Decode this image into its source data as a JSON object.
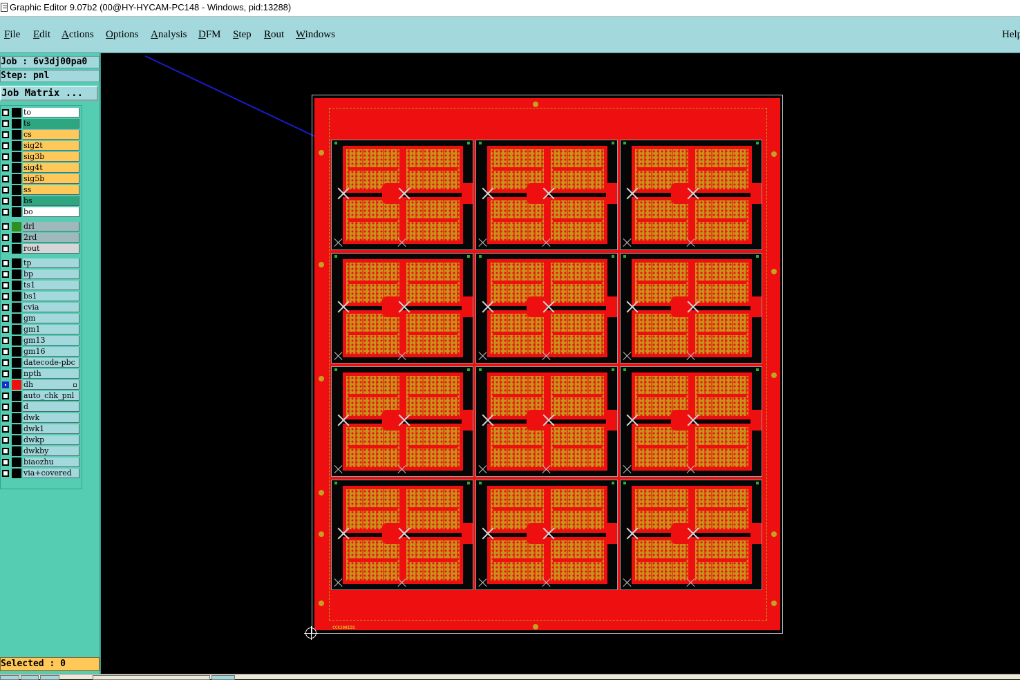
{
  "window": {
    "title": "Graphic Editor 9.07b2 (00@HY-HYCAM-PC148 - Windows, pid:13288)"
  },
  "menu": {
    "items": [
      "File",
      "Edit",
      "Actions",
      "Options",
      "Analysis",
      "DFM",
      "Step",
      "Rout",
      "Windows"
    ],
    "help": "Help"
  },
  "job": {
    "job_label": "Job : 6v3dj00pa0",
    "step_label": "Step: pnl",
    "matrix_button": "Job Matrix ..."
  },
  "layers": [
    {
      "name": "to",
      "type": "board",
      "color": "#000000",
      "checked": false
    },
    {
      "name": "ts",
      "type": "board",
      "color": "#000000",
      "checked": false
    },
    {
      "name": "cs",
      "type": "board",
      "color": "#000000",
      "checked": false
    },
    {
      "name": "sig2t",
      "type": "board",
      "color": "#000000",
      "checked": false
    },
    {
      "name": "sig3b",
      "type": "board",
      "color": "#000000",
      "checked": false
    },
    {
      "name": "sig4t",
      "type": "board",
      "color": "#000000",
      "checked": false
    },
    {
      "name": "sig5b",
      "type": "board",
      "color": "#000000",
      "checked": false
    },
    {
      "name": "ss",
      "type": "board",
      "color": "#000000",
      "checked": false
    },
    {
      "name": "bs",
      "type": "board",
      "color": "#000000",
      "checked": false
    },
    {
      "name": "bo",
      "type": "board",
      "color": "#000000",
      "checked": false
    },
    {
      "name": "drl",
      "type": "drill",
      "color": "#2f8e1f",
      "checked": false
    },
    {
      "name": "2rd",
      "type": "drill",
      "color": "#000000",
      "checked": false
    },
    {
      "name": "rout",
      "type": "rout",
      "color": "#000000",
      "checked": false
    },
    {
      "name": "tp",
      "type": "misc",
      "color": "#000000",
      "checked": false
    },
    {
      "name": "bp",
      "type": "misc",
      "color": "#000000",
      "checked": false
    },
    {
      "name": "ts1",
      "type": "misc",
      "color": "#000000",
      "checked": false
    },
    {
      "name": "bs1",
      "type": "misc",
      "color": "#000000",
      "checked": false
    },
    {
      "name": "cvia",
      "type": "misc",
      "color": "#000000",
      "checked": false
    },
    {
      "name": "gm",
      "type": "misc",
      "color": "#000000",
      "checked": false
    },
    {
      "name": "gm1",
      "type": "misc",
      "color": "#000000",
      "checked": false
    },
    {
      "name": "gm13",
      "type": "misc",
      "color": "#000000",
      "checked": false
    },
    {
      "name": "gm16",
      "type": "misc",
      "color": "#000000",
      "checked": false
    },
    {
      "name": "datecode-pbc",
      "type": "misc",
      "color": "#000000",
      "checked": false
    },
    {
      "name": "npth",
      "type": "misc",
      "color": "#000000",
      "checked": false
    },
    {
      "name": "dh",
      "type": "misc",
      "color": "#ee1010",
      "checked": true
    },
    {
      "name": "auto_chk_pnl",
      "type": "misc",
      "color": "#000000",
      "checked": false
    },
    {
      "name": "d",
      "type": "misc",
      "color": "#000000",
      "checked": false
    },
    {
      "name": "dwk",
      "type": "misc",
      "color": "#000000",
      "checked": false
    },
    {
      "name": "dwk1",
      "type": "misc",
      "color": "#000000",
      "checked": false
    },
    {
      "name": "dwkp",
      "type": "misc",
      "color": "#000000",
      "checked": false
    },
    {
      "name": "dwkby",
      "type": "misc",
      "color": "#000000",
      "checked": false
    },
    {
      "name": "biaozhu",
      "type": "misc",
      "color": "#000000",
      "checked": false
    },
    {
      "name": "via+covered",
      "type": "misc",
      "color": "#000000",
      "checked": false
    }
  ],
  "status": {
    "selected": "Selected : 0"
  },
  "board": {
    "panel_id_text": "CCXJ00IIG",
    "colors": {
      "copper": "#ee1010",
      "pad": "#c79219",
      "background": "#000000",
      "menu": "#a3d8dc",
      "panel": "#55cdb2",
      "arrow": "#1a1acc"
    },
    "array": {
      "rows": 4,
      "cols": 3,
      "units_per_block": 4
    }
  }
}
